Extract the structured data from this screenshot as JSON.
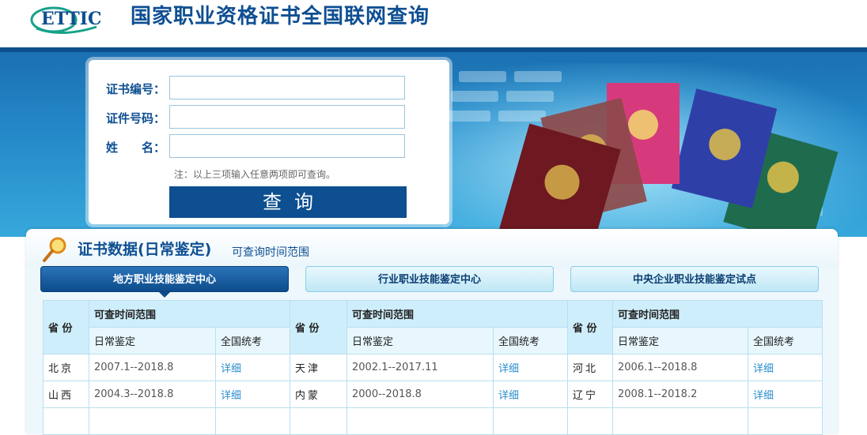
{
  "header": {
    "logo_text": "ETTIC",
    "site_title": "国家职业资格证书全国联网查询"
  },
  "search": {
    "cert_no_label": "证书编号：",
    "id_no_label": "证件号码：",
    "name_label": "姓　　名：",
    "cert_no_value": "",
    "id_no_value": "",
    "name_value": "",
    "note": "注：以上三项输入任意两项即可查询。",
    "button_label": "查询"
  },
  "section": {
    "title": "证书数据(日常鉴定)",
    "subtitle": "可查询时间范围"
  },
  "tabs": [
    {
      "label": "地方职业技能鉴定中心",
      "active": true
    },
    {
      "label": "行业职业技能鉴定中心",
      "active": false
    },
    {
      "label": "中央企业职业技能鉴定试点",
      "active": false
    }
  ],
  "table": {
    "province_header": "省 份",
    "range_header": "可查时间范围",
    "daily_header": "日常鉴定",
    "national_header": "全国统考",
    "rows": [
      [
        {
          "province": "北京",
          "range": "2007.1--2018.8",
          "link": "详细"
        },
        {
          "province": "天津",
          "range": "2002.1--2017.11",
          "link": "详细"
        },
        {
          "province": "河北",
          "range": "2006.1--2018.8",
          "link": "详细"
        }
      ],
      [
        {
          "province": "山西",
          "range": "2004.3--2018.8",
          "link": "详细"
        },
        {
          "province": "内蒙",
          "range": "2000--2018.8",
          "link": "详细"
        },
        {
          "province": "辽宁",
          "range": "2008.1--2018.2",
          "link": "详细"
        }
      ]
    ]
  },
  "colors": {
    "brand_blue": "#0e4f92",
    "banner_blue": "#2386c6",
    "link_blue": "#2a8ed0",
    "table_header_bg": "#cfeefb"
  }
}
